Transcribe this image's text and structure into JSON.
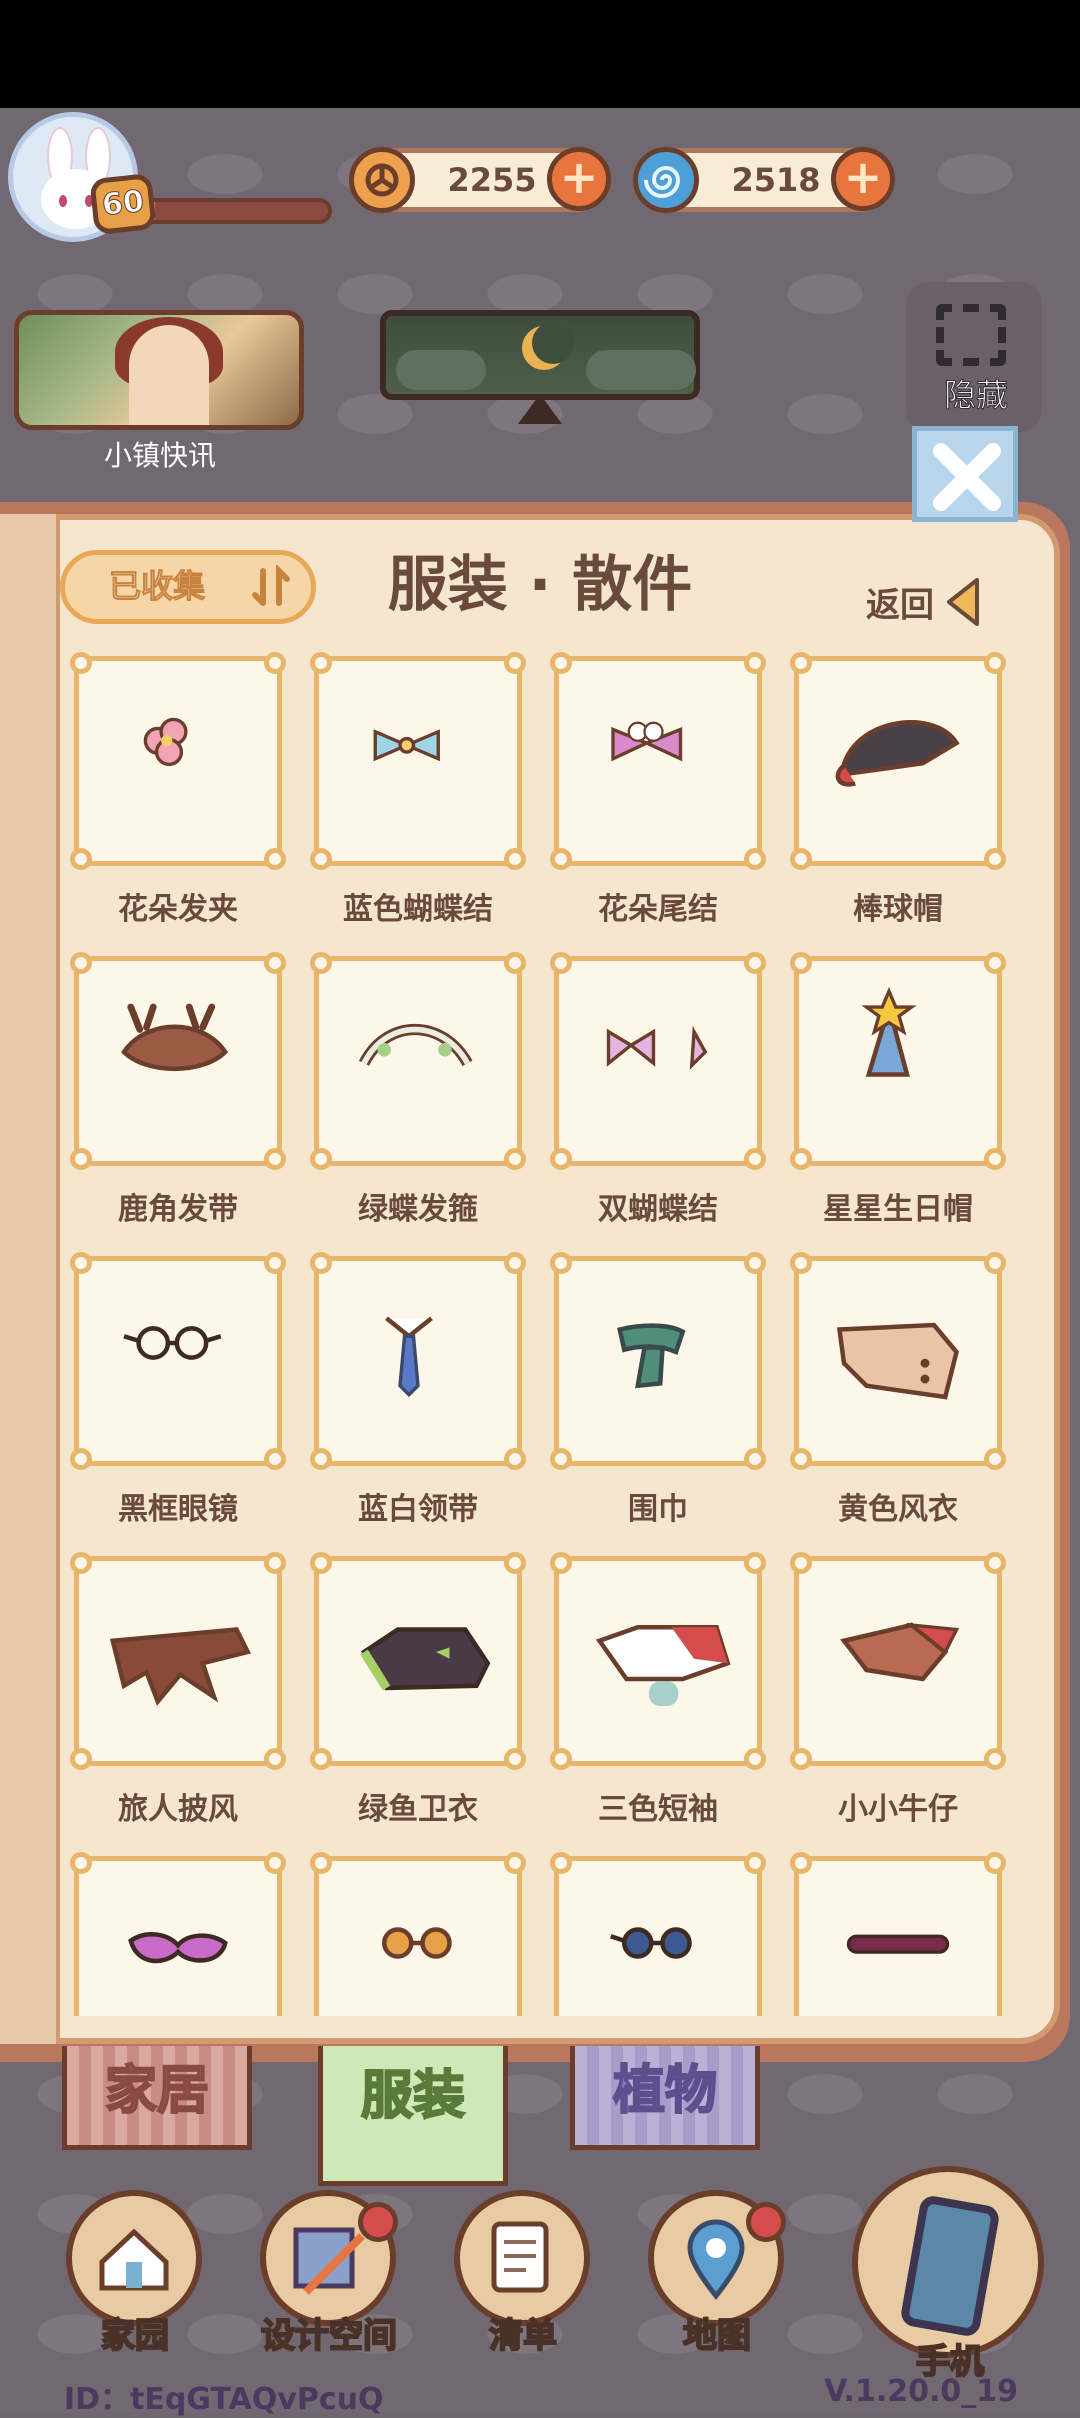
{
  "hud": {
    "level": "60",
    "xp_fraction": 0.06,
    "coins": "2255",
    "gems": "2518",
    "news_label": "小镇快讯",
    "hide_label": "隐藏"
  },
  "panel": {
    "title": "服装 · 散件",
    "collected_label": "已收集",
    "back_label": "返回"
  },
  "items": [
    {
      "name": "花朵发夹",
      "icon": "flower-hairclip-icon"
    },
    {
      "name": "蓝色蝴蝶结",
      "icon": "blue-bow-icon"
    },
    {
      "name": "花朵尾结",
      "icon": "flower-tail-bow-icon"
    },
    {
      "name": "棒球帽",
      "icon": "baseball-cap-icon"
    },
    {
      "name": "鹿角发带",
      "icon": "antler-headband-icon"
    },
    {
      "name": "绿蝶发箍",
      "icon": "green-butterfly-headband-icon"
    },
    {
      "name": "双蝴蝶结",
      "icon": "double-bow-icon"
    },
    {
      "name": "星星生日帽",
      "icon": "star-birthday-hat-icon"
    },
    {
      "name": "黑框眼镜",
      "icon": "black-frame-glasses-icon"
    },
    {
      "name": "蓝白领带",
      "icon": "blue-white-tie-icon"
    },
    {
      "name": "围巾",
      "icon": "scarf-icon"
    },
    {
      "name": "黄色风衣",
      "icon": "yellow-trenchcoat-icon"
    },
    {
      "name": "旅人披风",
      "icon": "traveler-cape-icon"
    },
    {
      "name": "绿鱼卫衣",
      "icon": "green-fish-hoodie-icon"
    },
    {
      "name": "三色短袖",
      "icon": "tricolor-tshirt-icon"
    },
    {
      "name": "小小牛仔",
      "icon": "little-cowboy-icon"
    },
    {
      "name": "",
      "icon": "gradient-sunglasses-icon"
    },
    {
      "name": "",
      "icon": "round-orange-glasses-icon"
    },
    {
      "name": "",
      "icon": "round-blue-glasses-icon"
    },
    {
      "name": "",
      "icon": "slim-glasses-icon"
    }
  ],
  "tabs": {
    "home": "家居",
    "clothes": "服装",
    "plants": "植物"
  },
  "nav": {
    "home": "家园",
    "design": "设计空间",
    "list": "清单",
    "map": "地图",
    "phone": "手机"
  },
  "footer": {
    "user_id": "ID：tEqGTAQvPcuQ",
    "version": "V.1.20.0_19"
  },
  "colors": {
    "panel_bg": "#f4e6cf",
    "card_border": "#e8b56a",
    "text_brown": "#6a4a3a",
    "accent_orange": "#e9753e",
    "badge_red": "#d64b4b"
  }
}
